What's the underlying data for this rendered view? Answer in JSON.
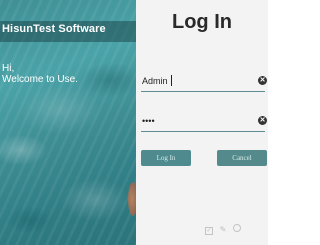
{
  "app": {
    "title": "HisunTest Software",
    "greeting_line1": "Hi,",
    "greeting_line2": "Welcome to Use."
  },
  "login": {
    "heading": "Log In",
    "username_value": "Admin",
    "password_value": "••••",
    "login_label": "Log In",
    "cancel_label": "Cancel"
  },
  "icons": {
    "clear": "clear-icon",
    "footer": [
      "checkbox-icon",
      "edit-icon",
      "settings-icon"
    ]
  },
  "colors": {
    "accent": "#4f8a8e",
    "panel_bg": "#f3f3f3"
  }
}
